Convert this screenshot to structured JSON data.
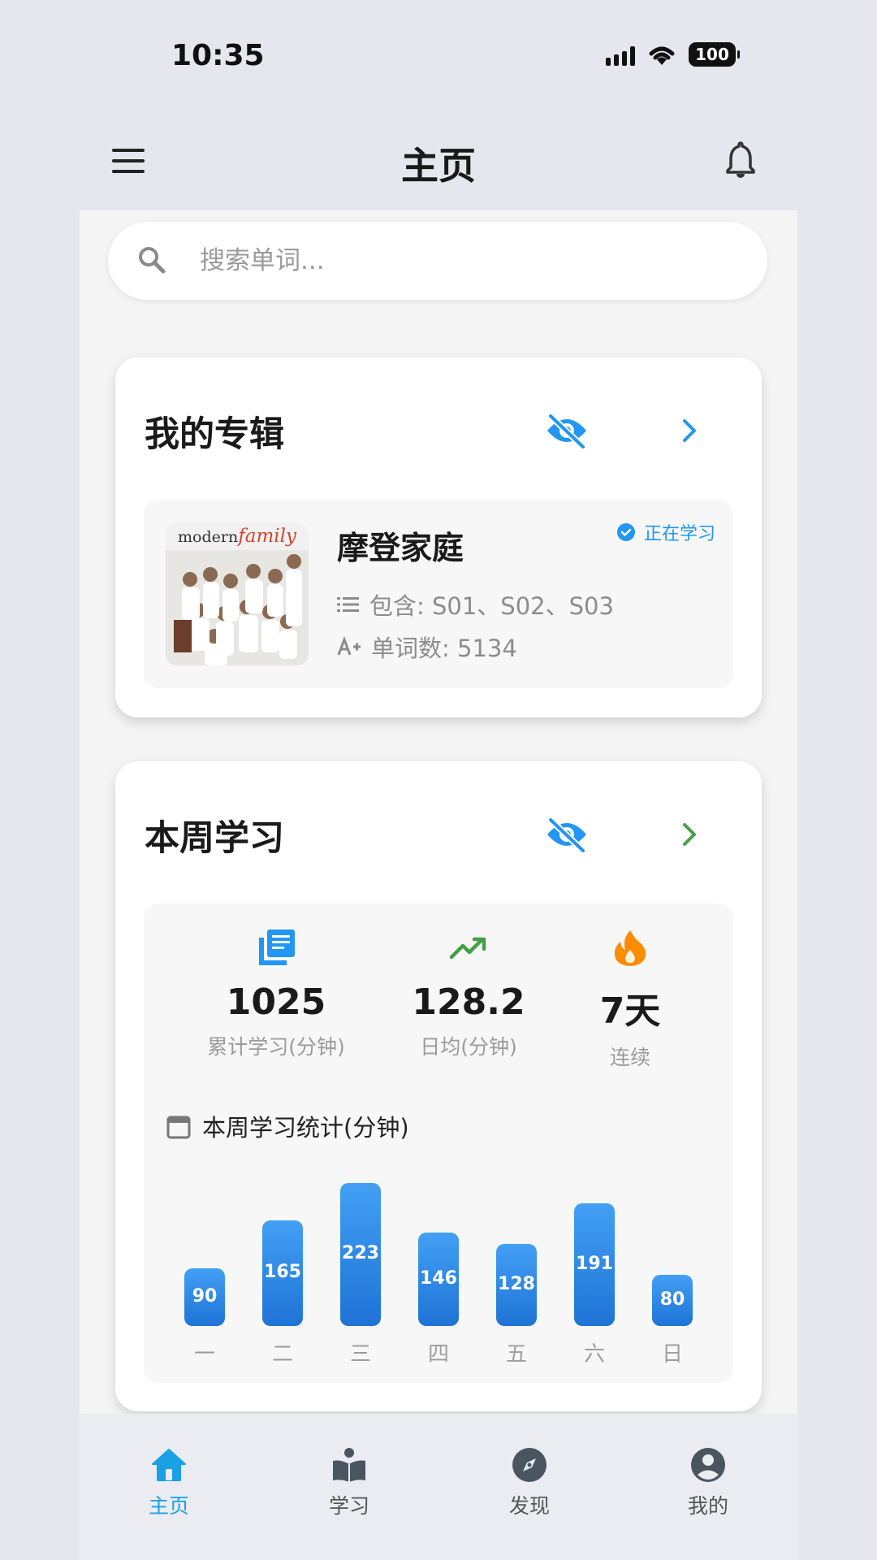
{
  "status": {
    "time": "10:35",
    "battery": "100"
  },
  "header": {
    "title": "主页"
  },
  "search": {
    "placeholder": "搜索单词..."
  },
  "album_card": {
    "title": "我的专辑",
    "album": {
      "logo_modern": "modern",
      "logo_family": "family",
      "title": "摩登家庭",
      "badge": "正在学习",
      "seasons": "包含: S01、S02、S03",
      "word_count": "单词数: 5134"
    }
  },
  "week_card": {
    "title": "本周学习",
    "stats": [
      {
        "value": "1025",
        "label": "累计学习(分钟)"
      },
      {
        "value": "128.2",
        "label": "日均(分钟)"
      },
      {
        "value": "7天",
        "label": "连续"
      }
    ],
    "chart_title": "本周学习统计(分钟)"
  },
  "chart_data": {
    "type": "bar",
    "categories": [
      "一",
      "二",
      "三",
      "四",
      "五",
      "六",
      "日"
    ],
    "values": [
      90,
      165,
      223,
      146,
      128,
      191,
      80
    ],
    "title": "本周学习统计(分钟)"
  },
  "nav": [
    {
      "label": "主页",
      "active": true
    },
    {
      "label": "学习",
      "active": false
    },
    {
      "label": "发现",
      "active": false
    },
    {
      "label": "我的",
      "active": false
    }
  ],
  "colors": {
    "accent": "#2196f3",
    "green": "#43a047",
    "orange": "#fb8c00",
    "nav_active": "#19a0e6"
  }
}
